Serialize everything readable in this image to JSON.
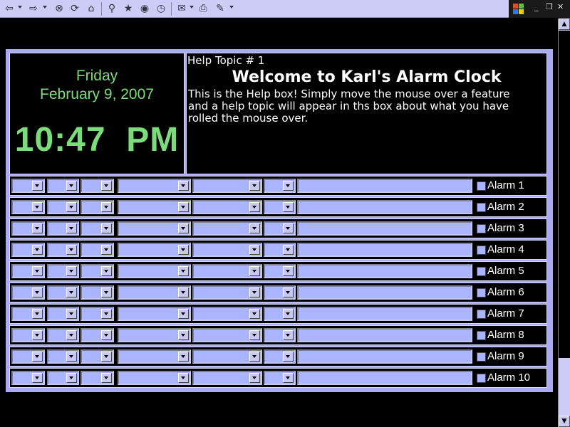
{
  "toolbar": {
    "icons": [
      "back-icon",
      "forward-icon",
      "stop-icon",
      "refresh-icon",
      "home-icon",
      "search-icon",
      "favorites-icon",
      "media-icon",
      "history-icon",
      "mail-icon",
      "print-icon",
      "edit-icon"
    ]
  },
  "window_controls": {
    "minimize": "_",
    "restore": "❐",
    "close": "✕"
  },
  "clock": {
    "day": "Friday",
    "date": "February 9, 2007",
    "time": "10:47  PM"
  },
  "help": {
    "label": "Help Topic # 1",
    "title": "Welcome to Karl's Alarm Clock",
    "text": "This is the Help box! Simply move the mouse over a feature and a help topic will appear in ths box about what you have rolled the mouse over."
  },
  "alarms": [
    {
      "label": "Alarm 1"
    },
    {
      "label": "Alarm 2"
    },
    {
      "label": "Alarm 3"
    },
    {
      "label": "Alarm 4"
    },
    {
      "label": "Alarm 5"
    },
    {
      "label": "Alarm 6"
    },
    {
      "label": "Alarm 7"
    },
    {
      "label": "Alarm 8"
    },
    {
      "label": "Alarm 9"
    },
    {
      "label": "Alarm 10"
    }
  ],
  "colors": {
    "panel": "#ababf3",
    "clock_text": "#7cdc7c",
    "field": "#aab4ff",
    "toolbar": "#ccccf6"
  }
}
